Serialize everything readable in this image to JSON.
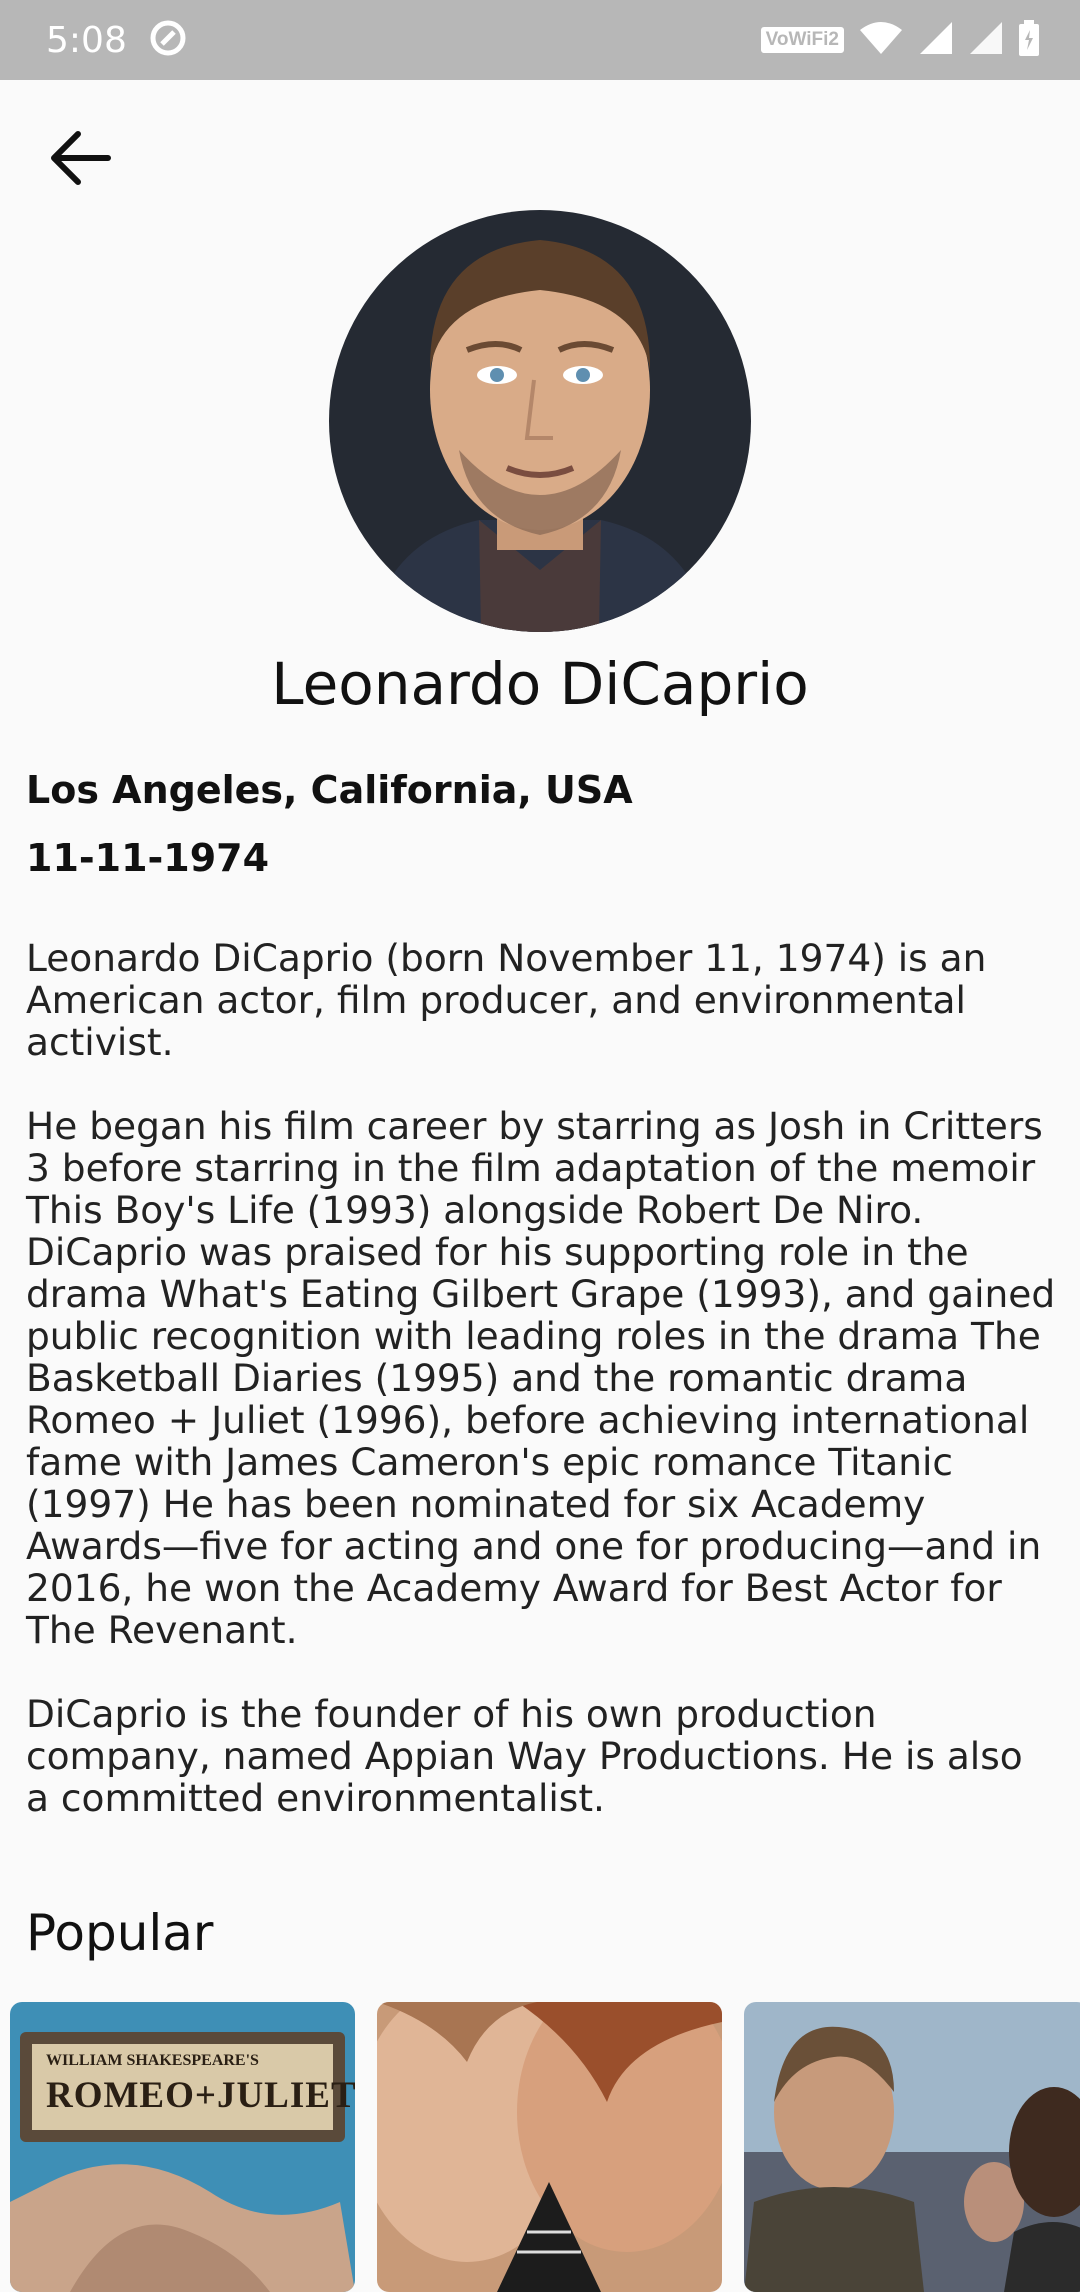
{
  "status_bar": {
    "time": "5:08",
    "network_badge": "VoWiFi2"
  },
  "header": {
    "back_icon": "arrow-left-icon"
  },
  "person": {
    "name": "Leonardo DiCaprio",
    "place_of_birth": "Los Angeles, California, USA",
    "birthday": "11-11-1974",
    "biography": [
      "Leonardo DiCaprio (born November 11, 1974) is an American actor, film producer, and environmental activist.",
      "He began his film career by starring as Josh in Critters 3 before starring in the film adaptation of the memoir This Boy's Life (1993) alongside Robert De Niro. DiCaprio was praised for his supporting role in the drama What's Eating Gilbert Grape (1993), and gained public recognition with leading roles in the drama The Basketball Diaries (1995) and the romantic drama Romeo + Juliet (1996), before achieving international fame with James Cameron's epic romance Titanic (1997) He has been nominated for six Academy Awards—five for acting and one for producing—and in 2016, he won the Academy Award for Best Actor for The Revenant.",
      "DiCaprio is the founder of his own production company, named Appian Way Productions. He is also a committed environmentalist."
    ]
  },
  "popular": {
    "title": "Popular",
    "posters": [
      {
        "poster_line1": "WILLIAM SHAKESPEARE'S",
        "poster_line2": "ROMEO+JULIET"
      },
      {
        "poster_line1": "",
        "poster_line2": ""
      },
      {
        "poster_line1": "",
        "poster_line2": ""
      }
    ]
  },
  "colors": {
    "background": "#fafafa",
    "status_bar": "#b7b7b7",
    "text": "#111111"
  }
}
